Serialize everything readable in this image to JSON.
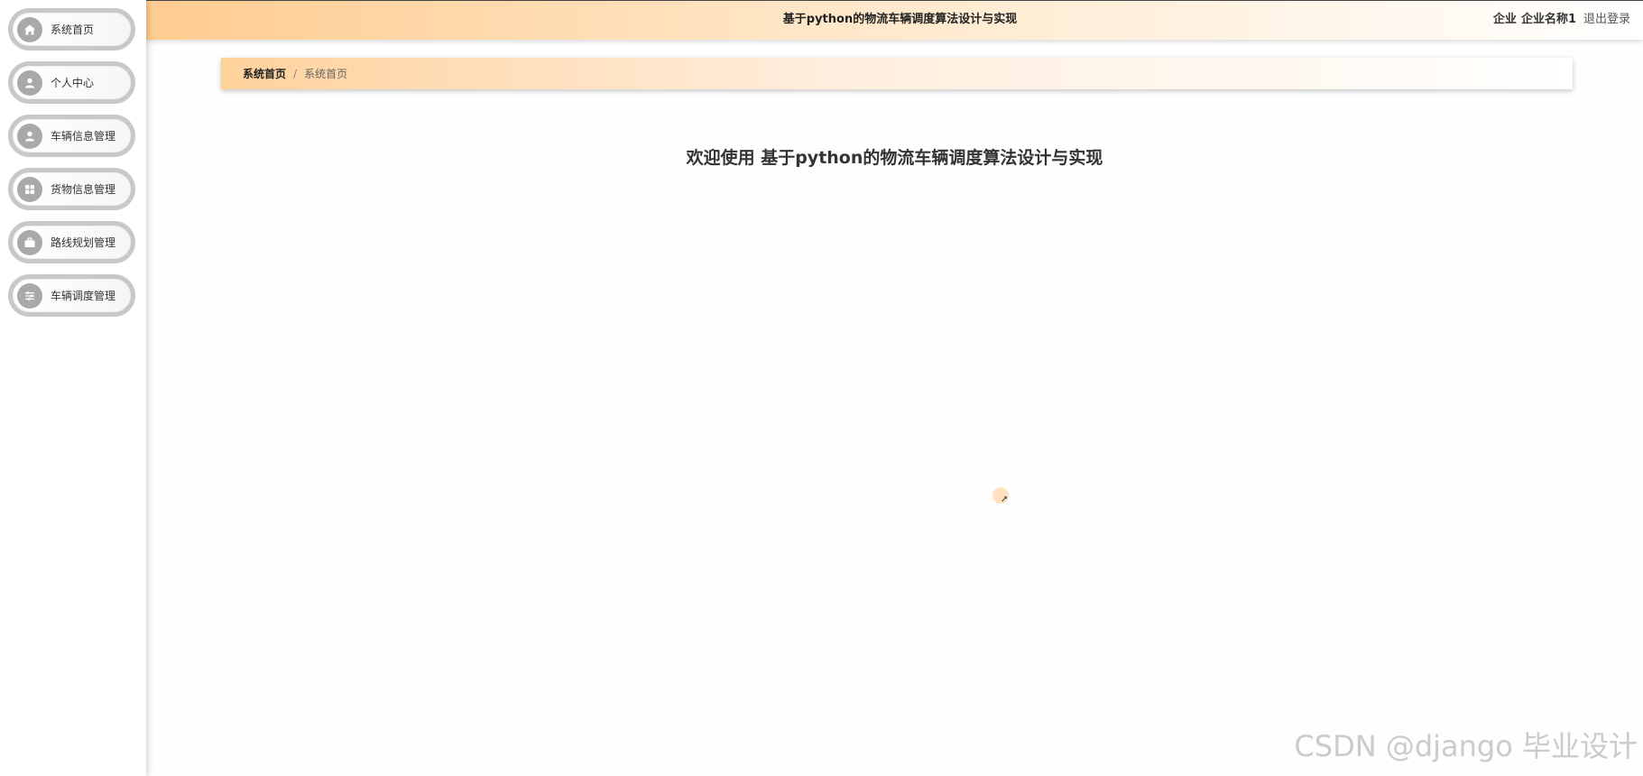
{
  "header": {
    "title": "基于python的物流车辆调度算法设计与实现",
    "user_role": "企业",
    "user_name": "企业名称1",
    "logout_label": "退出登录"
  },
  "sidebar": {
    "items": [
      {
        "label": "系统首页",
        "icon": "home-icon"
      },
      {
        "label": "个人中心",
        "icon": "user-icon"
      },
      {
        "label": "车辆信息管理",
        "icon": "user-icon"
      },
      {
        "label": "货物信息管理",
        "icon": "grid-icon"
      },
      {
        "label": "路线规划管理",
        "icon": "briefcase-icon"
      },
      {
        "label": "车辆调度管理",
        "icon": "sliders-icon"
      }
    ]
  },
  "breadcrumb": {
    "home": "系统首页",
    "separator": "/",
    "current": "系统首页"
  },
  "main": {
    "welcome": "欢迎使用 基于python的物流车辆调度算法设计与实现"
  },
  "watermark": "CSDN @django 毕业设计",
  "colors": {
    "header_accent": "#ffcc90",
    "icon_bg": "#a9a9a9",
    "nav_border": "#c8c8c8"
  }
}
